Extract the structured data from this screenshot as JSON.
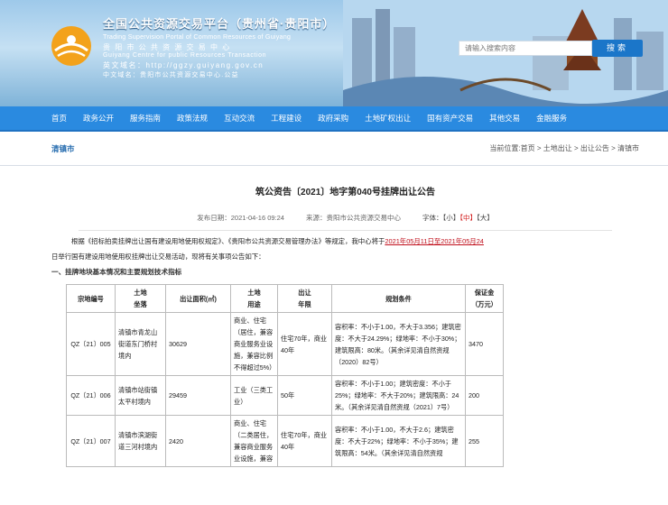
{
  "header": {
    "title_cn": "全国公共资源交易平台（贵州省·贵阳市）",
    "title_en": "Trading Supervision Portal of Common Resources of Guiyang",
    "center_cn": "贵 阳 市 公 共 资 源 交 易 中 心",
    "center_en": "Guiyang  Centre  for  public  Resources  Transaction",
    "domain_en": "英文域名：http://ggzy.guiyang.gov.cn",
    "domain_cn": "中文域名：贵阳市公共资源交易中心.公益",
    "search_placeholder": "请输入搜索内容",
    "search_button": "搜索"
  },
  "nav": {
    "items": [
      "首页",
      "政务公开",
      "服务指南",
      "政策法规",
      "互动交流",
      "工程建设",
      "政府采购",
      "土地矿权出让",
      "国有资产交易",
      "其他交易",
      "金融服务"
    ]
  },
  "crumb": {
    "city": "清镇市",
    "location": "当前位置:首页 > 土地出让 > 出让公告 > 清镇市"
  },
  "article": {
    "title": "筑公资告〔2021〕地字第040号挂牌出让公告",
    "publish": "发布日期：2021-04-16 09:24",
    "source": "来源：贵阳市公共资源交易中心",
    "font_label": "字体：",
    "font_small": "【小】",
    "font_mid": "【中】",
    "font_large": "【大】",
    "intro_a": "根据《招标拍卖挂牌出让国有建设用地使用权规定》、《贵阳市公共资源交易管理办法》等规定，我中心将于",
    "intro_date": "2021年05月11日至2021年05月24",
    "intro_b": "日举行国有建设用地使用权挂牌出让交易活动，现将有关事项公告如下：",
    "section1": "一、挂牌地块基本情况和主要规划技术指标"
  },
  "table": {
    "headers": {
      "code": "宗地编号",
      "loc1": "土地",
      "loc2": "坐落",
      "area": "出让面积(㎡)",
      "use1": "土地",
      "use2": "用途",
      "term1": "出让",
      "term2": "年限",
      "plan": "规划条件",
      "dep1": "保证金",
      "dep2": "（万元）"
    },
    "rows": [
      {
        "code": "QZ〔21〕005",
        "loc": "清镇市青龙山街道东门桥村境内",
        "area": "30629",
        "use": "商业、住宅（居住，兼容商业服务业设施，兼容比例不得超过5%）",
        "term": "住宅70年，商业40年",
        "plan": "容积率：不小于1.00，不大于3.356；建筑密度：不大于24.29%；绿地率：不小于30%；建筑限高：80米。（其余详见清自然资规（2020）82号）",
        "deposit": "3470"
      },
      {
        "code": "QZ〔21〕006",
        "loc": "清镇市站街镇太平村境内",
        "area": "29459",
        "use": "工业（三类工业）",
        "term": "50年",
        "plan": "容积率：不小于1.00；建筑密度：不小于25%；绿地率：不大于20%；建筑限高：24米。（其余详见清自然资规（2021）7号）",
        "deposit": "200"
      },
      {
        "code": "QZ〔21〕007",
        "loc": "清镇市滨湖街道三河村境内",
        "area": "2420",
        "use": "商业、住宅（二类居住，兼容商业服务业设施，兼容",
        "term": "住宅70年，商业40年",
        "plan": "容积率：不小于1.00，不大于2.6；建筑密度：不大于22%；绿地率：不小于35%；建筑限高：54米。（其余详见清自然资规",
        "deposit": "255"
      }
    ]
  }
}
